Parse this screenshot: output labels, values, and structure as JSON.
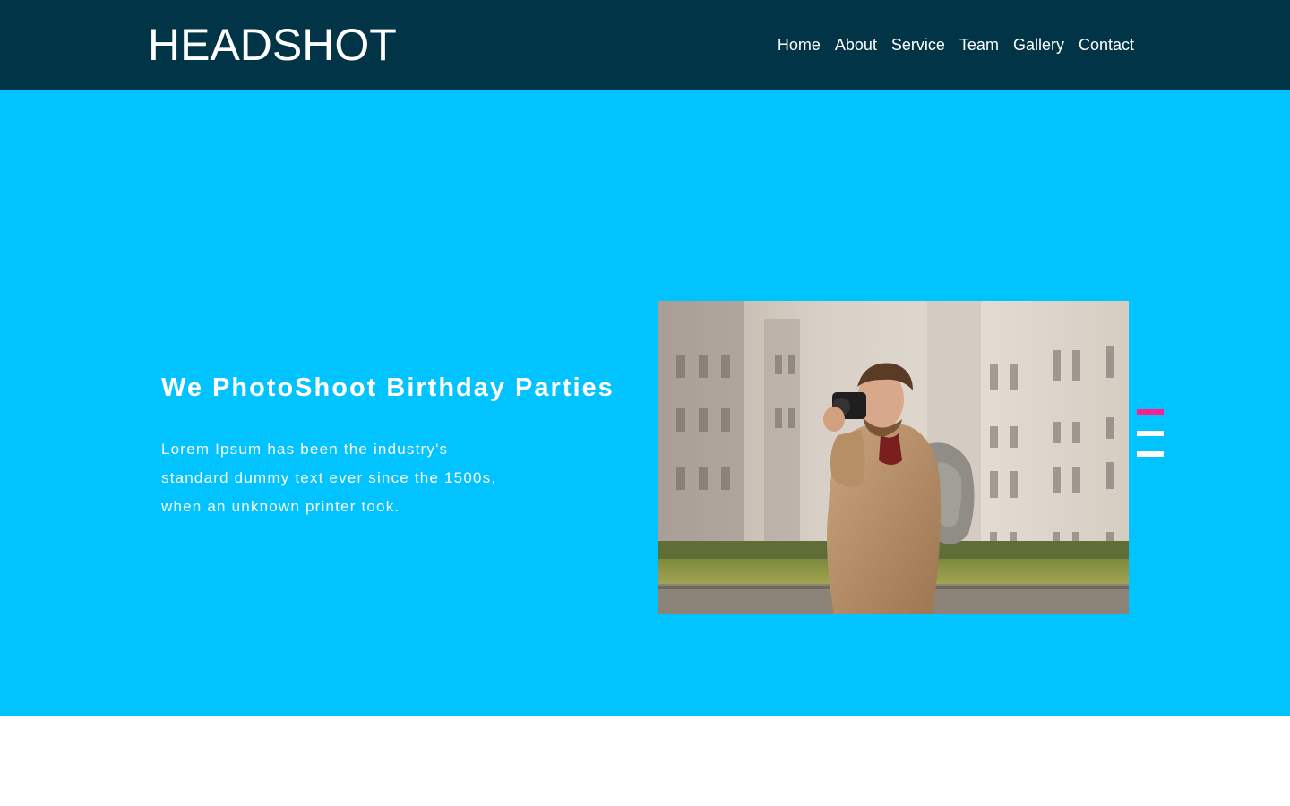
{
  "brand": {
    "logo_text": "HEADSHOT"
  },
  "nav": {
    "items": [
      {
        "label": "Home"
      },
      {
        "label": "About"
      },
      {
        "label": "Service"
      },
      {
        "label": "Team"
      },
      {
        "label": "Gallery"
      },
      {
        "label": "Contact"
      }
    ]
  },
  "hero": {
    "title": "We PhotoShoot Birthday Parties",
    "description": "Lorem Ipsum has been the industry's standard dummy text ever since the 1500s, when an unknown printer took.",
    "image_alt": "Man taking a photo with a camera in front of a historic building"
  },
  "slider": {
    "active_index": 1,
    "dot_count": 3,
    "active_color": "#ff1f8f",
    "inactive_color": "#ffffff"
  },
  "colors": {
    "navbar_bg": "#023448",
    "hero_bg": "#00c3ff",
    "text": "#ffffff"
  }
}
